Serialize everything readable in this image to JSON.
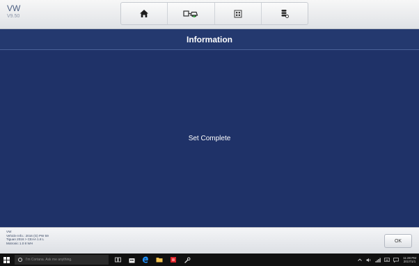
{
  "header": {
    "make": "VW",
    "version": "V9.50",
    "toolbar": {
      "icons": [
        "home-icon",
        "vehicle-swap-icon",
        "screenshot-icon",
        "data-logging-icon"
      ]
    }
  },
  "title": "Information",
  "message": "Set Complete",
  "footer": {
    "vehicle_lines": [
      "VW",
      "Vehicle Info.: 2016 (G) PW 59",
      "Tiguan 2016 > CEAA 1.8 L",
      "Motronic 1.0 8 WH"
    ],
    "ok_label": "OK"
  },
  "taskbar": {
    "search_placeholder": "I'm Cortana. Ask me anything.",
    "time": "11:28 PM",
    "date": "2017/1/1"
  },
  "colors": {
    "background": "#1f3268",
    "title_bar": "#24396f",
    "header": "#e9ebee",
    "taskbar": "#101010"
  }
}
